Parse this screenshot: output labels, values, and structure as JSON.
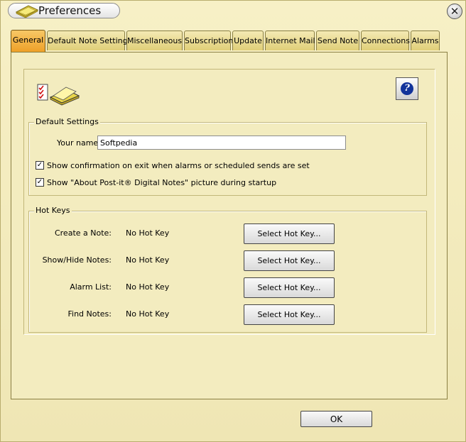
{
  "window": {
    "title": "Preferences",
    "close_glyph": "✕"
  },
  "tabs": [
    {
      "label": "General",
      "active": true
    },
    {
      "label": "Default Note Settings",
      "active": false
    },
    {
      "label": "Miscellaneous",
      "active": false
    },
    {
      "label": "Subscription",
      "active": false
    },
    {
      "label": "Update",
      "active": false
    },
    {
      "label": "Internet Mail",
      "active": false
    },
    {
      "label": "Send Note",
      "active": false
    },
    {
      "label": "Connections",
      "active": false
    },
    {
      "label": "Alarms",
      "active": false
    }
  ],
  "help": {
    "glyph": "?"
  },
  "default_settings": {
    "legend": "Default Settings",
    "name_label": "Your name:",
    "name_value": "Softpedia",
    "checkboxes": [
      {
        "label": "Show confirmation on exit when alarms or scheduled sends are set",
        "checked": true,
        "mark": "✓"
      },
      {
        "label": "Show \"About Post-it® Digital Notes\" picture during startup",
        "checked": true,
        "mark": "✓"
      }
    ]
  },
  "hot_keys": {
    "legend": "Hot Keys",
    "rows": [
      {
        "label": "Create a Note:",
        "value": "No Hot Key",
        "button": "Select Hot Key..."
      },
      {
        "label": "Show/Hide Notes:",
        "value": "No Hot Key",
        "button": "Select Hot Key..."
      },
      {
        "label": "Alarm List:",
        "value": "No Hot Key",
        "button": "Select Hot Key..."
      },
      {
        "label": "Find Notes:",
        "value": "No Hot Key",
        "button": "Select Hot Key..."
      }
    ]
  },
  "footer": {
    "ok_label": "OK"
  },
  "icons": {
    "title": "post-it-notes-icon",
    "app": "post-it-checklist-icon",
    "help": "help-icon",
    "close": "close-icon"
  },
  "colors": {
    "window_bg": "#efe6b4",
    "active_tab": "#ee9f26",
    "tab": "#e0cf78",
    "help_blue": "#12339a"
  }
}
